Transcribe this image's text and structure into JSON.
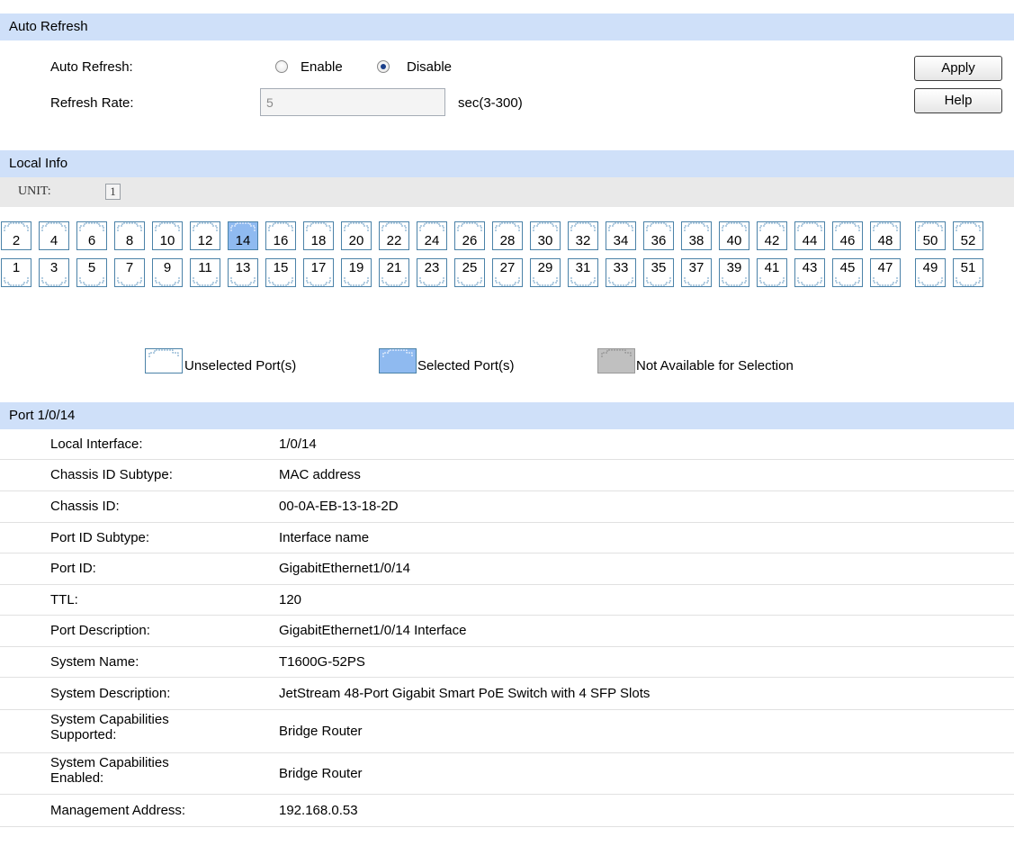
{
  "auto_refresh": {
    "header": "Auto Refresh",
    "auto_refresh_label": "Auto Refresh:",
    "enable_label": "Enable",
    "disable_label": "Disable",
    "selected": "Disable",
    "refresh_rate_label": "Refresh Rate:",
    "refresh_rate_value": "5",
    "refresh_rate_unit": "sec(3-300)",
    "apply_label": "Apply",
    "help_label": "Help"
  },
  "local_info": {
    "header": "Local Info",
    "unit_label": "UNIT:",
    "unit_value": "1",
    "ports_top": [
      "2",
      "4",
      "6",
      "8",
      "10",
      "12",
      "14",
      "16",
      "18",
      "20",
      "22",
      "24",
      "26",
      "28",
      "30",
      "32",
      "34",
      "36",
      "38",
      "40",
      "42",
      "44",
      "46",
      "48",
      "50",
      "52"
    ],
    "ports_bottom": [
      "1",
      "3",
      "5",
      "7",
      "9",
      "11",
      "13",
      "15",
      "17",
      "19",
      "21",
      "23",
      "25",
      "27",
      "29",
      "31",
      "33",
      "35",
      "37",
      "39",
      "41",
      "43",
      "45",
      "47",
      "49",
      "51"
    ],
    "selected_port": "14",
    "legend": {
      "unselected": "Unselected Port(s)",
      "selected": "Selected Port(s)",
      "not_available": "Not Available for Selection"
    }
  },
  "port_info": {
    "header": "Port 1/0/14",
    "rows": [
      {
        "label": "Local Interface:",
        "value": "1/0/14"
      },
      {
        "label": "Chassis ID Subtype:",
        "value": "MAC address"
      },
      {
        "label": "Chassis ID:",
        "value": "00-0A-EB-13-18-2D"
      },
      {
        "label": "Port ID Subtype:",
        "value": "Interface name"
      },
      {
        "label": "Port ID:",
        "value": "GigabitEthernet1/0/14"
      },
      {
        "label": "TTL:",
        "value": "120"
      },
      {
        "label": "Port Description:",
        "value": "GigabitEthernet1/0/14 Interface"
      },
      {
        "label": "System Name:",
        "value": "T1600G-52PS"
      },
      {
        "label": "System Description:",
        "value": "JetStream 48-Port Gigabit Smart PoE Switch with 4 SFP Slots"
      },
      {
        "label": "System Capabilities\nSupported:",
        "value": "Bridge Router"
      },
      {
        "label": "System Capabilities\nEnabled:",
        "value": "Bridge Router"
      },
      {
        "label": "Management Address:",
        "value": "192.168.0.53"
      }
    ]
  },
  "colors": {
    "header_bg": "#cfe0f9",
    "selected_port": "#8fbaf0",
    "not_available": "#c0c0c0",
    "port_border": "#4b82a8"
  }
}
